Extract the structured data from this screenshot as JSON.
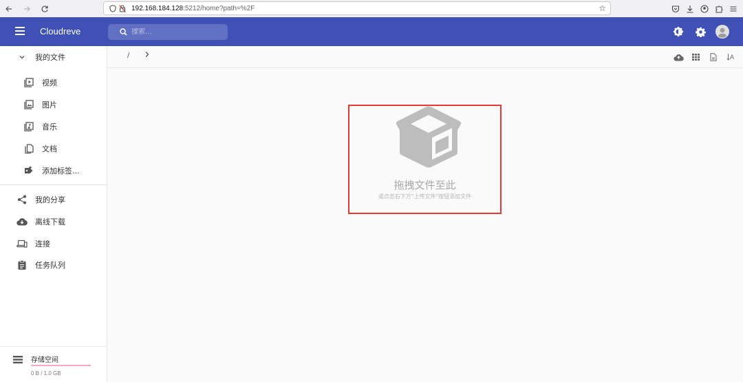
{
  "browser": {
    "url_host": "192.168.184.128",
    "url_rest": ":5212/home?path=%2F"
  },
  "app": {
    "title": "Cloudreve",
    "search_placeholder": "搜索...",
    "accent_color": "#3f51b5"
  },
  "sidebar": {
    "my_files": "我的文件",
    "sub_items": [
      {
        "label": "视频",
        "icon": "video-icon"
      },
      {
        "label": "图片",
        "icon": "image-icon"
      },
      {
        "label": "音乐",
        "icon": "music-icon"
      },
      {
        "label": "文档",
        "icon": "document-icon"
      },
      {
        "label": "添加标签...",
        "icon": "tag-add-icon"
      }
    ],
    "main_items": [
      {
        "label": "我的分享",
        "icon": "share-icon"
      },
      {
        "label": "离线下载",
        "icon": "cloud-download-icon"
      },
      {
        "label": "连接",
        "icon": "devices-icon"
      },
      {
        "label": "任务队列",
        "icon": "clipboard-icon"
      }
    ],
    "storage": {
      "label": "存储空间",
      "size": "0 B / 1.0 GB",
      "used_fraction": 0.0
    }
  },
  "toolbar": {
    "breadcrumb_root": "/",
    "sort_label": "A"
  },
  "empty_state": {
    "title": "拖拽文件至此",
    "subtitle": "或点击右下方\"上传文件\"按钮添加文件"
  }
}
